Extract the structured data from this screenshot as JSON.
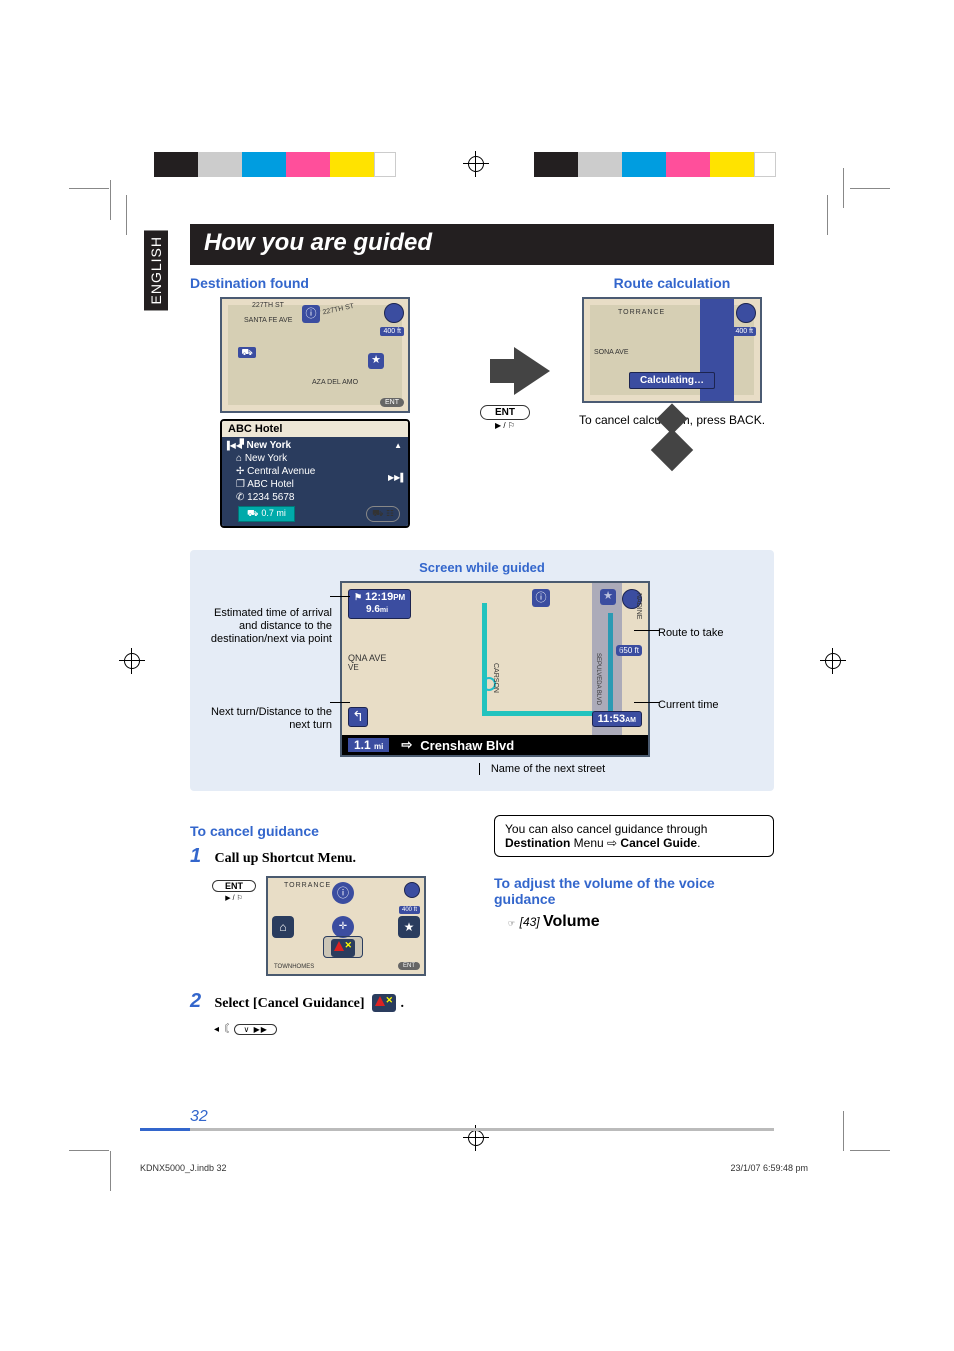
{
  "domain_tag": "Document",
  "lang_tab": "ENGLISH",
  "title": "How you are guided",
  "destination_found": {
    "heading": "Destination found",
    "map_scale": "400 ft",
    "ent_badge": "ENT",
    "panel_title": "ABC Hotel",
    "rows": [
      "New York",
      "New York",
      "Central Avenue",
      "ABC Hotel",
      "1234 5678"
    ],
    "distance_chip": "0.7 mi"
  },
  "route_calc": {
    "heading": "Route calculation",
    "map_label": "TORRANCE",
    "scale": "400 ft",
    "banner": "Calculating…",
    "cancel_hint": "To cancel calculation, press BACK."
  },
  "guided": {
    "title": "Screen while guided",
    "eta_time": "12:19",
    "eta_ampm": "PM",
    "eta_dist": "9.6",
    "eta_unit": "mi",
    "scale": "650 ft",
    "current_time": "11:53",
    "current_ampm": "AM",
    "next_dist": "1.1",
    "next_unit": "mi",
    "next_street": "Crenshaw Blvd",
    "label_eta": "Estimated time of arrival and distance to the destination/next via point",
    "label_route": "Route to take",
    "label_current": "Current time",
    "label_next": "Next turn/Distance to the next turn",
    "label_street": "Name of the next street",
    "map_street1": "QNA",
    "map_street2": "AVE",
    "map_street_side": "NADINE",
    "map_street_carson": "CARSON",
    "map_street_sepulveda": "SEPULVEDA BLVD"
  },
  "cancel": {
    "heading": "To cancel guidance",
    "step1": "Call up Shortcut Menu.",
    "step1_num": "1",
    "step2_num": "2",
    "step2": "Select [Cancel Guidance]",
    "ent": "ENT",
    "shortcut_map_label": "TORRANCE",
    "shortcut_bottom": "TOWNHOMES",
    "shortcut_ent": "ENT"
  },
  "side": {
    "note_pre": "You can also cancel guidance through",
    "note_menu1": "Destination",
    "note_menu_mid": " Menu ⇨ ",
    "note_menu2": "Cancel Guide",
    "vol_heading": "To adjust the volume of the voice guidance",
    "vol_link_icon": "☞",
    "vol_link_num": "[43]",
    "vol_link_word": "Volume"
  },
  "page_number": "32",
  "footer_left": "KDNX5000_J.indb   32",
  "footer_right": "23/1/07   6:59:48 pm",
  "icons": {
    "north": "N",
    "play": "▶",
    "prev": "▐◀◀",
    "next": "▶▶▌",
    "star": "★",
    "car": "⛟",
    "flag": "⚑",
    "info": "ⓘ",
    "home": "⌂",
    "tel": "✆",
    "arrow_right": "⇨",
    "down_next": "∨ ▶▶"
  }
}
